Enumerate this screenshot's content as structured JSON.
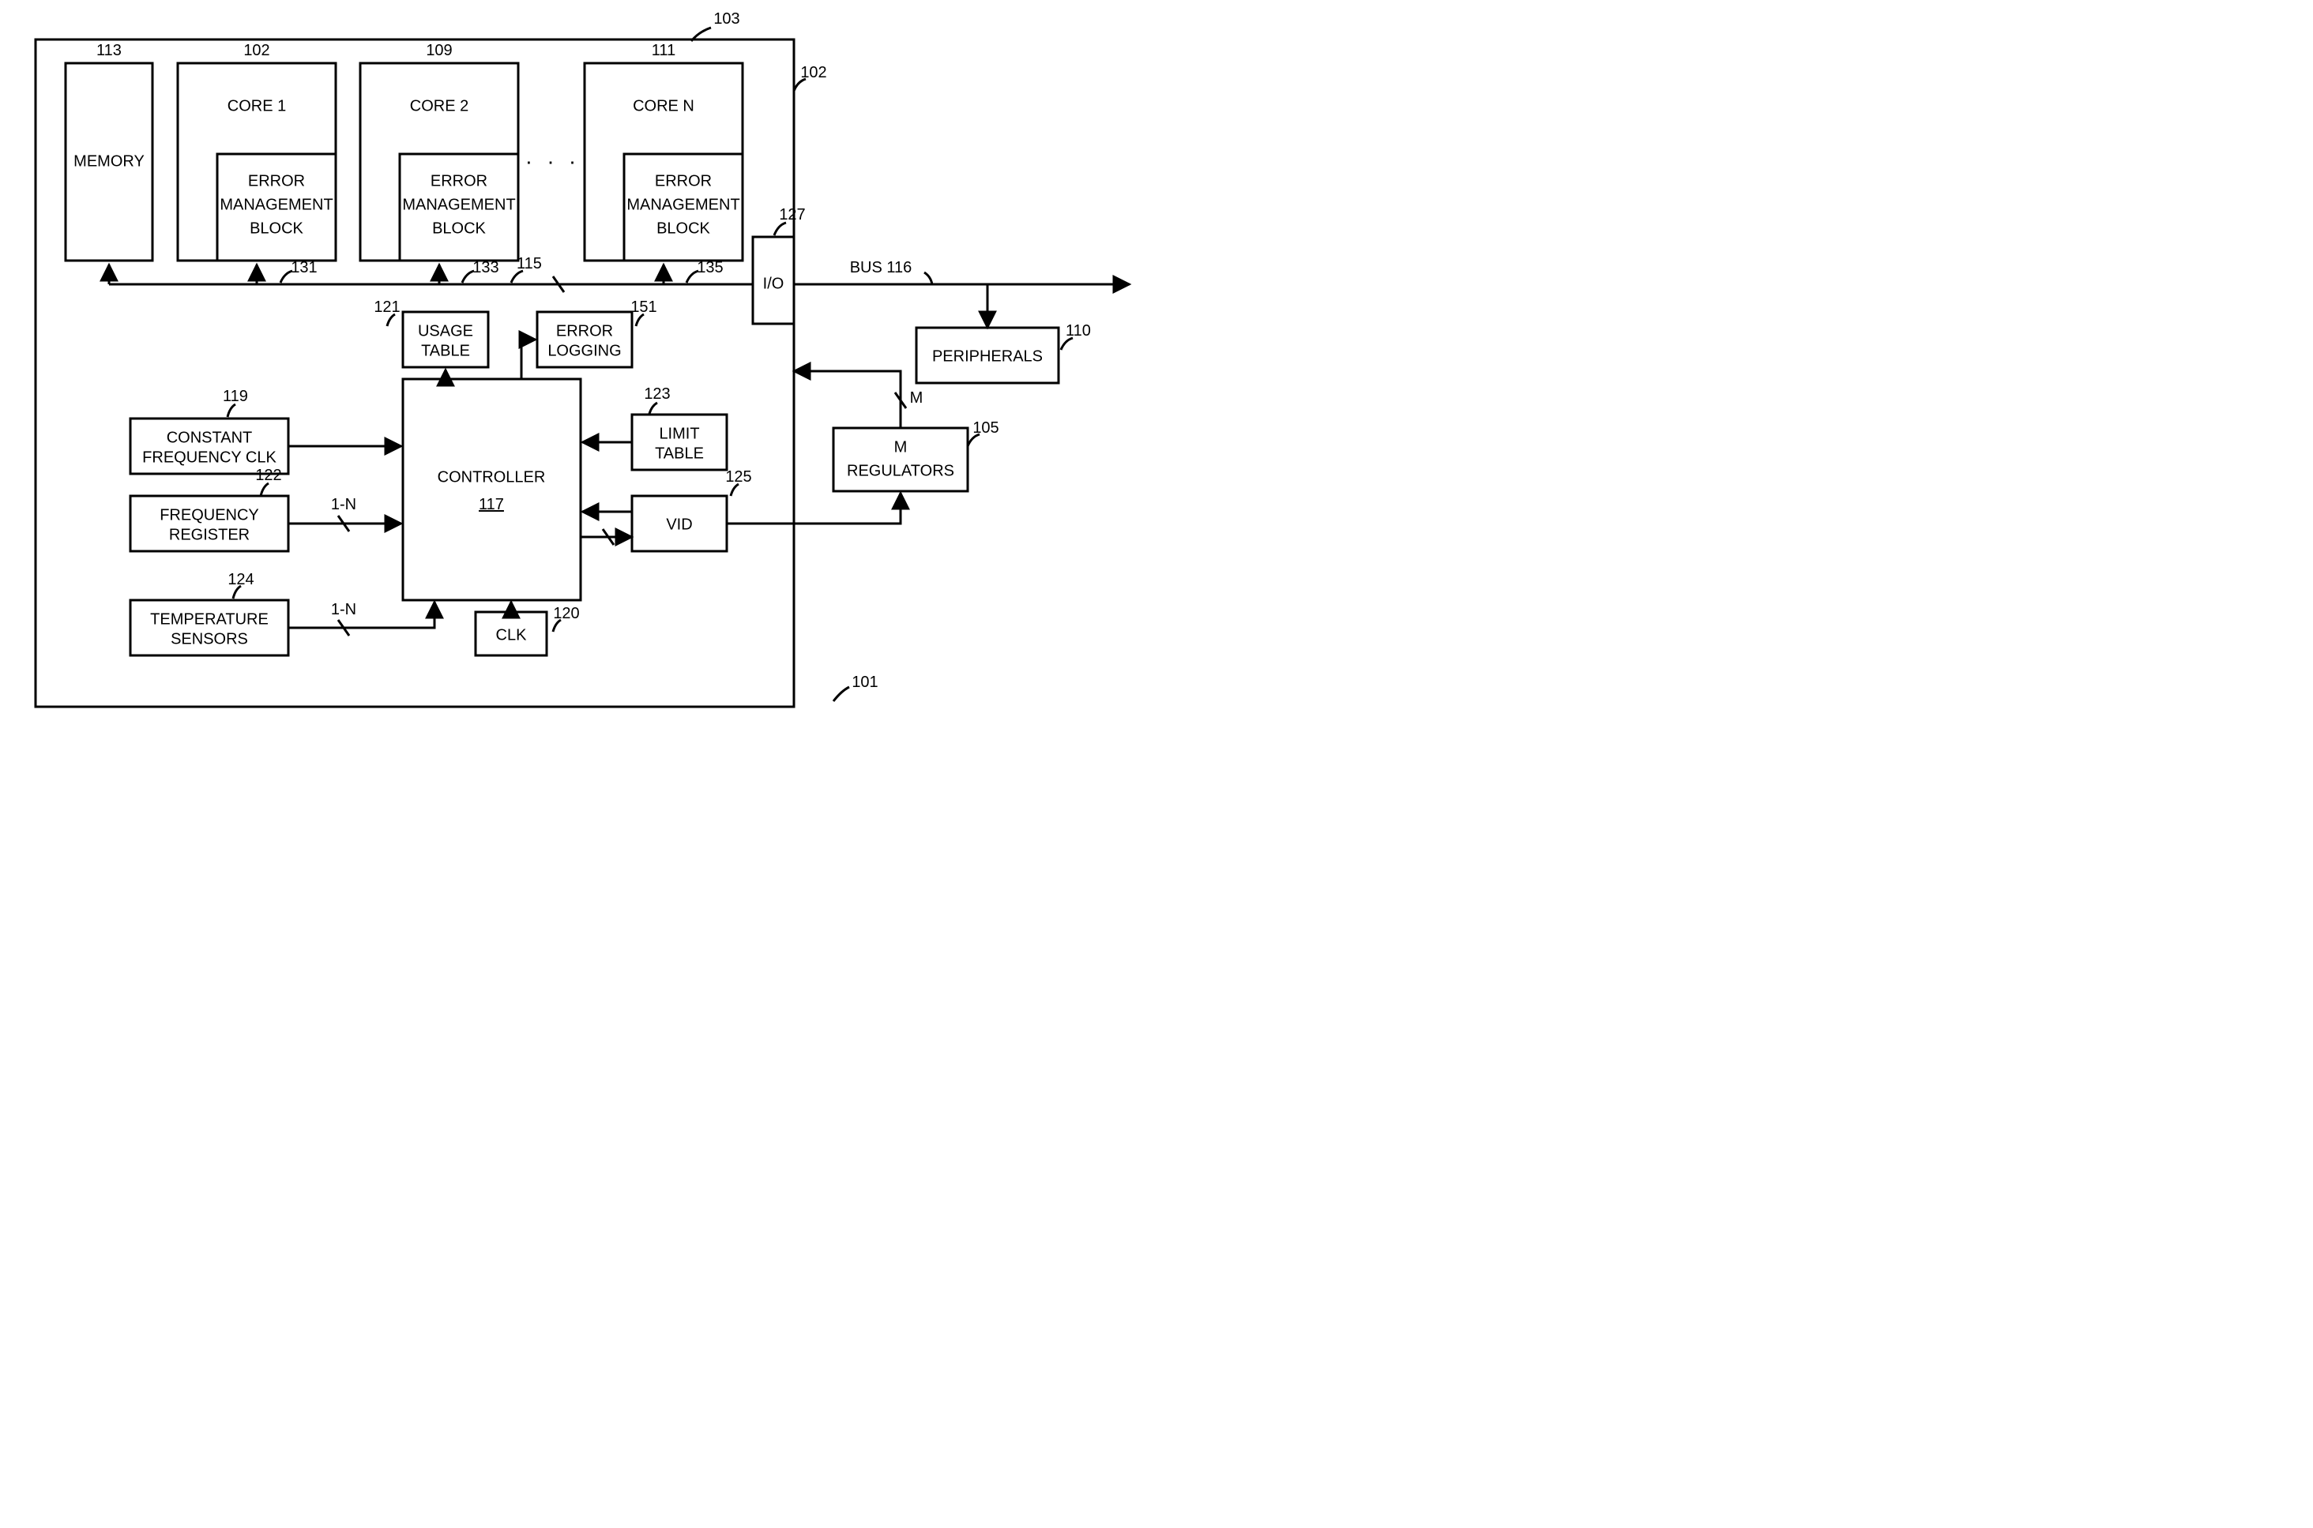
{
  "refs": {
    "outer_ic": "103",
    "system": "101",
    "ic_side": "102",
    "memory": "113",
    "core1": "102",
    "core2": "109",
    "coreN": "111",
    "emb1": "131",
    "emb2": "133",
    "embN": "135",
    "bus_inner": "115",
    "io": "127",
    "bus_ext": "BUS 116",
    "peripherals": "110",
    "m_regulators": "105",
    "usage_table": "121",
    "error_logging": "151",
    "constant_clk": "119",
    "freq_register": "122",
    "temp_sensors": "124",
    "limit_table": "123",
    "vid": "125",
    "clk": "120",
    "controller": "117"
  },
  "labels": {
    "memory": "MEMORY",
    "core1": "CORE 1",
    "core2": "CORE 2",
    "coreN": "CORE N",
    "emb_l1": "ERROR",
    "emb_l2": "MANAGEMENT",
    "emb_l3": "BLOCK",
    "io": "I/O",
    "peripherals": "PERIPHERALS",
    "mreg_l1": "M",
    "mreg_l2": "REGULATORS",
    "usage_l1": "USAGE",
    "usage_l2": "TABLE",
    "errlog_l1": "ERROR",
    "errlog_l2": "LOGGING",
    "constclk_l1": "CONSTANT",
    "constclk_l2": "FREQUENCY CLK",
    "freqreg_l1": "FREQUENCY",
    "freqreg_l2": "REGISTER",
    "temp_l1": "TEMPERATURE",
    "temp_l2": "SENSORS",
    "limit_l1": "LIMIT",
    "limit_l2": "TABLE",
    "vid": "VID",
    "clk": "CLK",
    "controller": "CONTROLLER",
    "slash_m": "M",
    "slash_1n": "1-N",
    "dots": ". . ."
  }
}
